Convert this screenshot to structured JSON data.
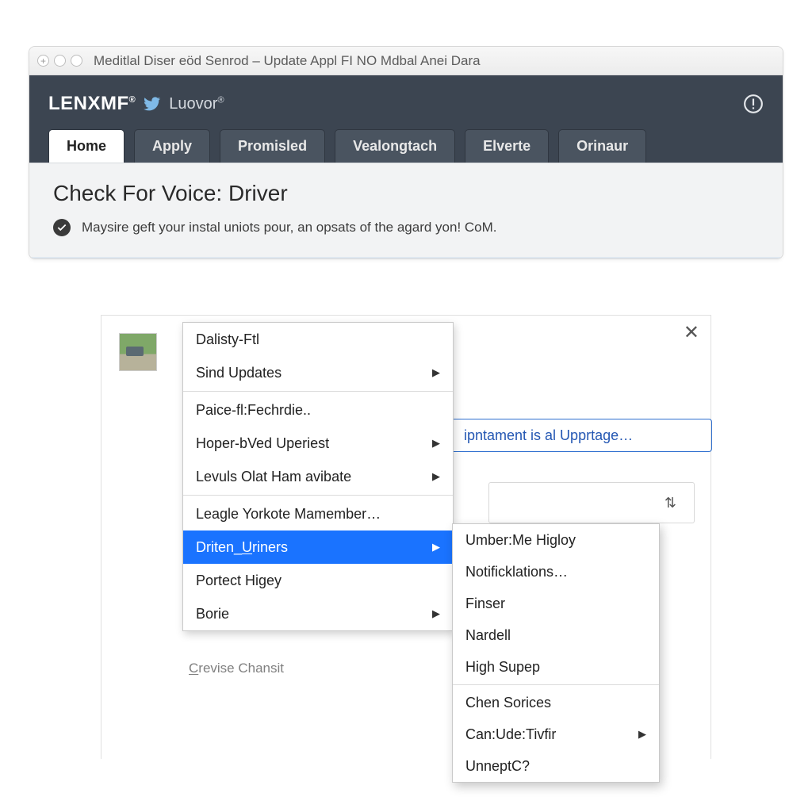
{
  "window": {
    "title": "Meditlal Diser eöd Senrod – Update Appl FI NO Mdbal Anei Dara"
  },
  "brand": {
    "name": "LENXMF",
    "sub": "Luovor"
  },
  "tabs": [
    {
      "label": "Home",
      "active": true
    },
    {
      "label": "Apply",
      "active": false
    },
    {
      "label": "Promisled",
      "active": false
    },
    {
      "label": "Vealongtach",
      "active": false
    },
    {
      "label": "Elverte",
      "active": false
    },
    {
      "label": "Orinaur",
      "active": false
    }
  ],
  "page": {
    "heading": "Check For Voice: Driver",
    "status": "Maysire geft your instal uniots pour, an opsats of the agard yon! CoM."
  },
  "panel": {
    "blue_suffix": "ipntament is al Upprtage…",
    "hidden_glyph": "⇅",
    "footnote_pre": "C",
    "footnote_rest": "revise Chansit"
  },
  "menu": {
    "items": [
      {
        "label": "Dalisty-Ftl",
        "arrow": false
      },
      {
        "label": "Sind Updates",
        "arrow": true
      },
      {
        "label": "Paice-fl:Fechrdie..",
        "arrow": false,
        "sep_before": true
      },
      {
        "label": "Hoper-bVed Uperiest",
        "arrow": true
      },
      {
        "label": "Levuls Olat Ham avibate",
        "arrow": true
      },
      {
        "label": "Leagle Yorkote Mamember…",
        "arrow": false,
        "sep_before": true
      },
      {
        "label_pre": "Driten",
        "label_mid": "U",
        "label_post": "riners",
        "arrow": true,
        "selected": true
      },
      {
        "label": "Portect Higey",
        "arrow": false
      },
      {
        "label": "Borie",
        "arrow": true
      }
    ]
  },
  "submenu": {
    "items": [
      {
        "label": "Umber:Me Higloy",
        "arrow": false
      },
      {
        "label": "Notificklations…",
        "arrow": false
      },
      {
        "label": "Finser",
        "arrow": false
      },
      {
        "label": "Nardell",
        "arrow": false
      },
      {
        "label": "High Supep",
        "arrow": false
      },
      {
        "label": "Chen Sorices",
        "arrow": false,
        "sep_before": true
      },
      {
        "label": "Can:Ude:Tivfir",
        "arrow": true
      },
      {
        "label": "UnneptC?",
        "arrow": false
      }
    ]
  }
}
